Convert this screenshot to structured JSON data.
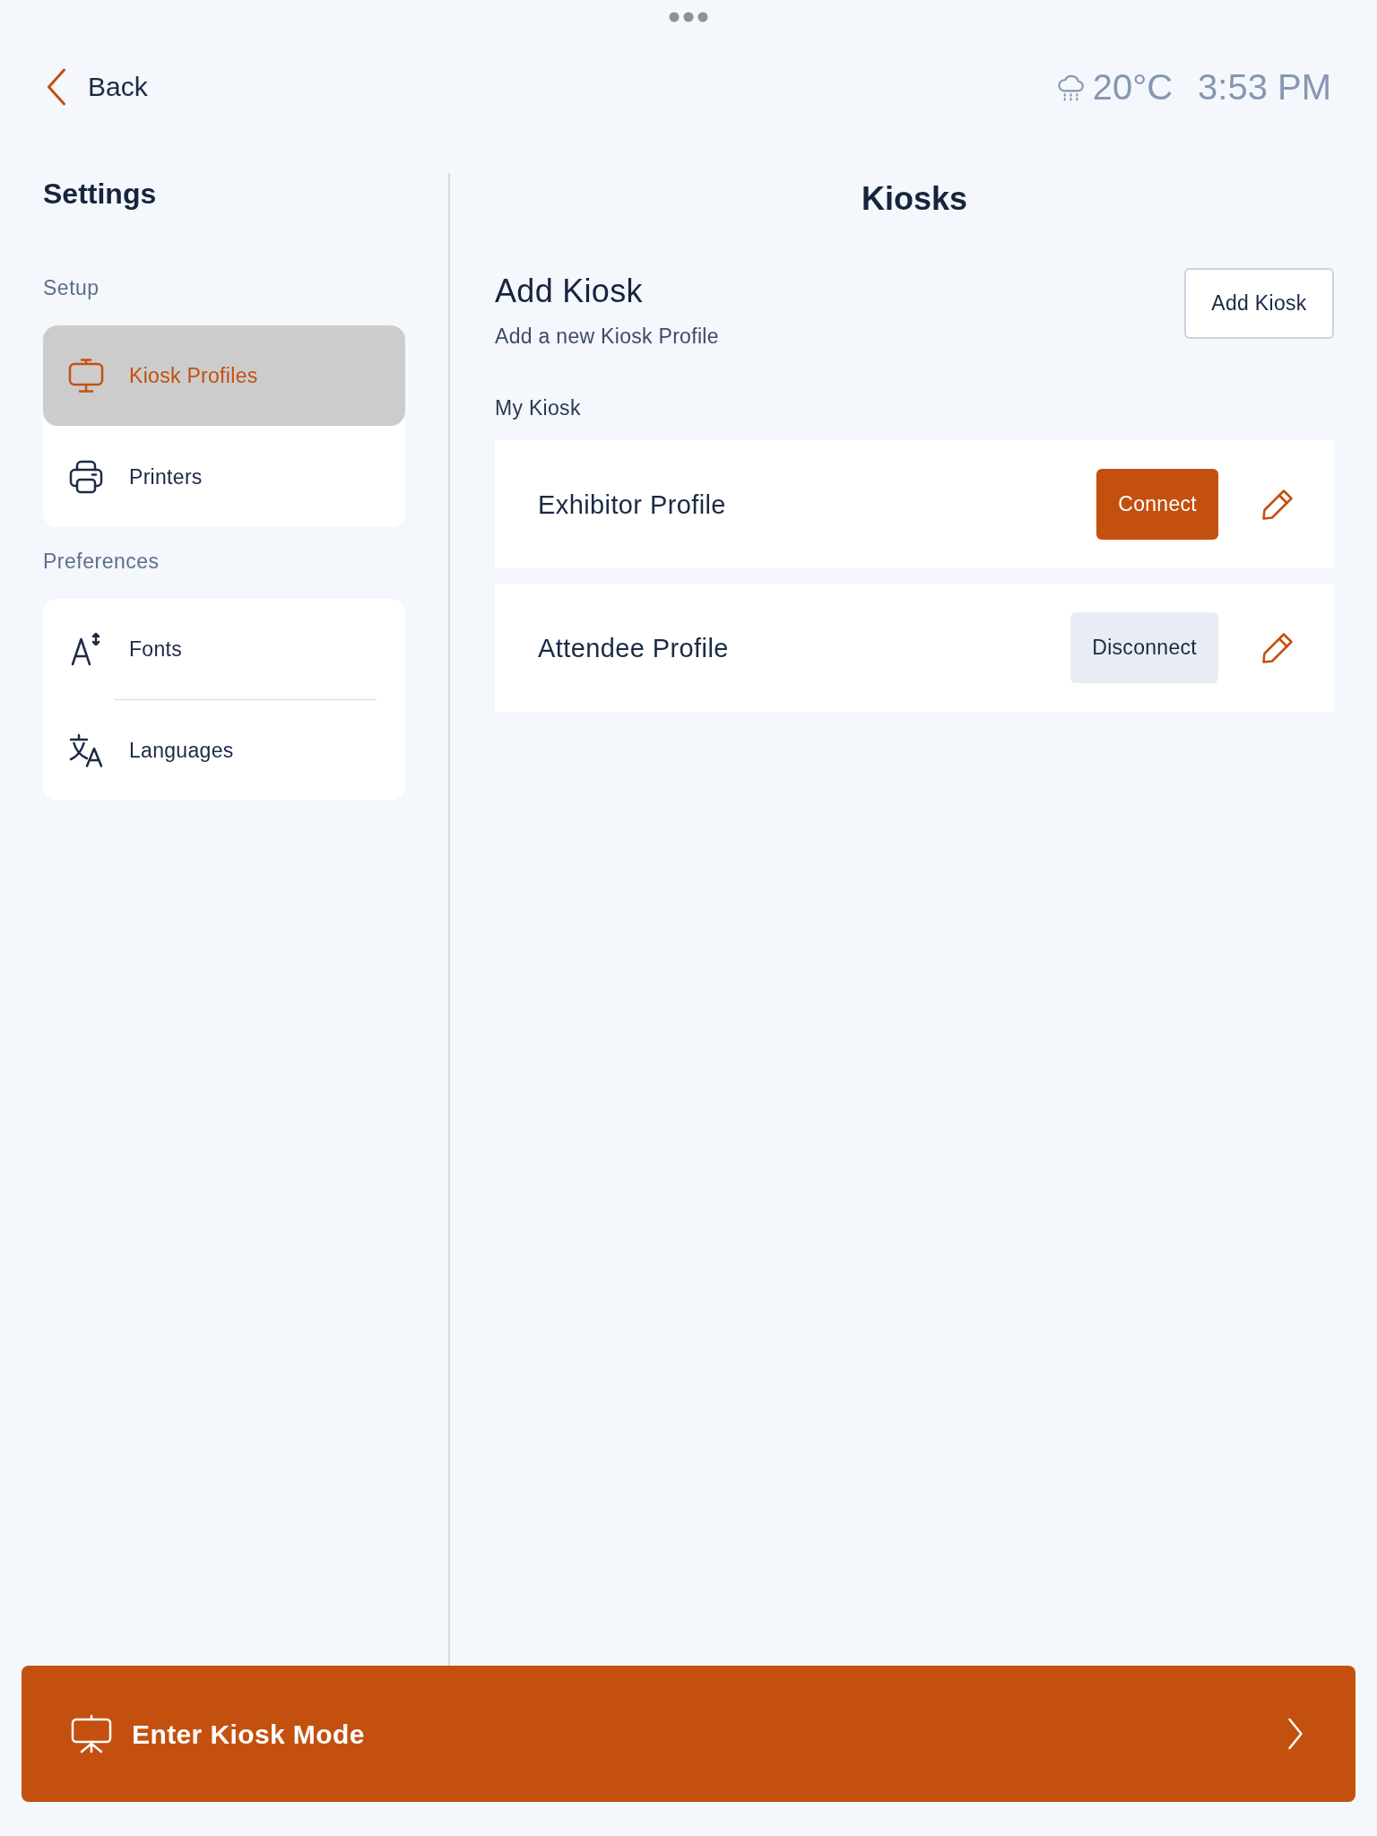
{
  "top_bar": {
    "back": {
      "label": "Back"
    },
    "temperature": "20°C",
    "time": "3:53 PM"
  },
  "sidebar": {
    "title": "Settings",
    "sections": [
      {
        "label": "Setup",
        "items": [
          {
            "label": "Kiosk Profiles",
            "selected": true
          },
          {
            "label": "Printers",
            "selected": false
          }
        ]
      },
      {
        "label": "Preferences",
        "items": [
          {
            "label": "Fonts",
            "selected": false
          },
          {
            "label": "Languages",
            "selected": false
          }
        ]
      }
    ]
  },
  "main": {
    "title": "Kiosks",
    "add_section": {
      "title": "Add Kiosk",
      "subtitle": "Add a new Kiosk Profile",
      "button": "Add Kiosk"
    },
    "list_label": "My Kiosk",
    "kiosks": [
      {
        "name": "Exhibitor Profile",
        "connected": false,
        "action": "Connect"
      },
      {
        "name": "Attendee Profile",
        "connected": true,
        "action": "Disconnect"
      }
    ]
  },
  "bottom_bar": {
    "label": "Enter Kiosk Mode"
  }
}
